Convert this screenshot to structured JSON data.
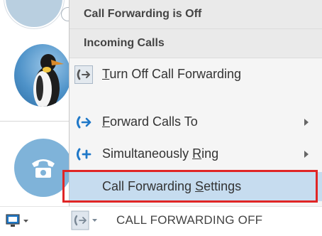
{
  "menu": {
    "header_status": "Call Forwarding is Off",
    "section_title": "Incoming Calls",
    "items": [
      {
        "label": "Turn Off Call Forwarding",
        "accel": "T",
        "icon": "turn-off-forwarding-icon",
        "submenu": false,
        "selected": true
      },
      {
        "label": "Forward Calls To",
        "accel": "F",
        "icon": "forward-calls-icon",
        "submenu": true,
        "selected": false
      },
      {
        "label": "Simultaneously Ring",
        "accel": "R",
        "icon": "simultaneous-ring-icon",
        "submenu": true,
        "selected": false
      },
      {
        "label": "Call Forwarding Settings",
        "accel": "S",
        "icon": "",
        "submenu": false,
        "selected": false,
        "hovered": true
      }
    ]
  },
  "status_bar": {
    "forwarding_status": "CALL FORWARDING OFF"
  },
  "colors": {
    "accent_blue": "#1f78c8",
    "highlight": "#c6dcef",
    "annotation_red": "#e02525"
  }
}
